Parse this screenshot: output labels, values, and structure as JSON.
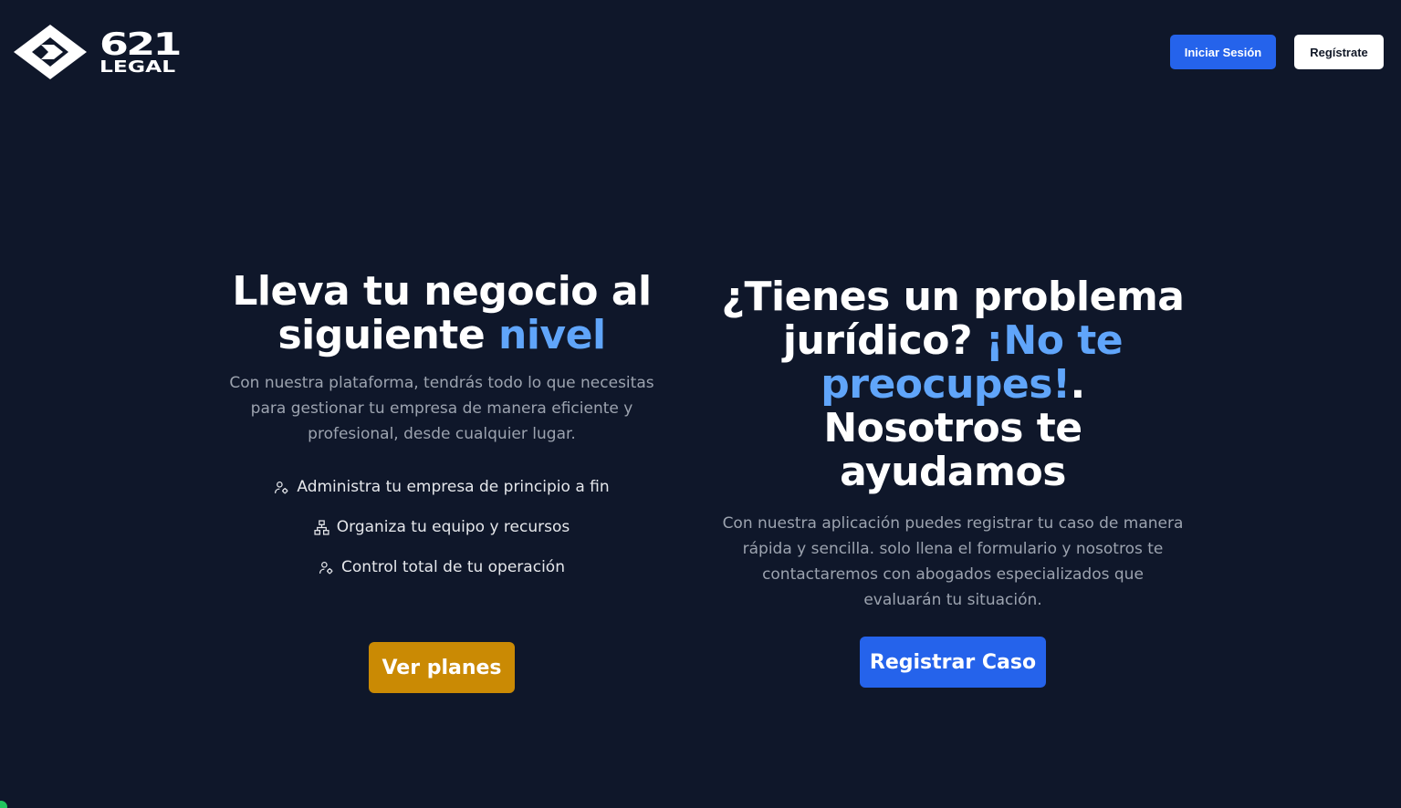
{
  "header": {
    "logo": {
      "number": "621",
      "word": "LEGAL",
      "icon": "diamond-logo-icon"
    },
    "login_label": "Iniciar Sesión",
    "register_label": "Regístrate"
  },
  "business": {
    "title_part1": "Lleva tu negocio al siguiente ",
    "title_accent": "nivel",
    "description": "Con nuestra plataforma, tendrás todo lo que necesitas para gestionar tu empresa de manera eficiente y profesional, desde cualquier lugar.",
    "features": [
      {
        "icon": "user-gear-icon",
        "label": "Administra tu empresa de principio a fin"
      },
      {
        "icon": "org-chart-icon",
        "label": "Organiza tu equipo y recursos"
      },
      {
        "icon": "user-gear-icon",
        "label": "Control total de tu operación"
      }
    ],
    "cta_label": "Ver planes"
  },
  "legal": {
    "title_part1": "¿Tienes un problema jurídico? ",
    "title_accent": "¡No te preocupes!",
    "title_part2": ". Nosotros te ayudamos",
    "description": "Con nuestra aplicación puedes registrar tu caso de manera rápida y sencilla. solo llena el formulario y nosotros te contactaremos con abogados especializados que evaluarán tu situación.",
    "cta_label": "Registrar Caso"
  },
  "colors": {
    "background": "#0f172a",
    "accent": "#60a5fa",
    "primary_button": "#2563eb",
    "plans_button": "#ca8a04"
  }
}
